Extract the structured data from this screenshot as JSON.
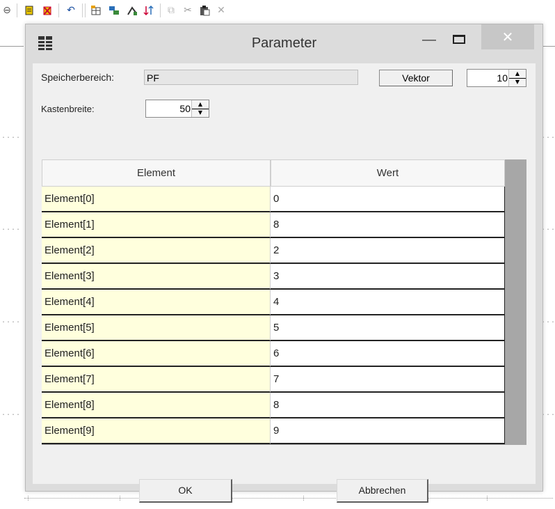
{
  "toolbar": {
    "icons": [
      "zoom-out-icon",
      "note-yellow-icon",
      "bomb-icon",
      "undo-icon",
      "table-insert-icon",
      "copy-blocks-icon",
      "route-icon",
      "sort-icon",
      "copy-icon",
      "cut-icon",
      "paste-icon",
      "delete-icon"
    ]
  },
  "dialog": {
    "title": "Parameter",
    "close_glyph": "✕",
    "minimize_glyph": "—",
    "mem_label": "Speicherbereich:",
    "mem_value": "PF",
    "vector_button": "Vektor",
    "vector_count": "10",
    "box_width_label": "Kastenbreite:",
    "box_width_value": "50",
    "columns": [
      "Element",
      "Wert"
    ],
    "rows": [
      {
        "name": "Element[0]",
        "value": "0"
      },
      {
        "name": "Element[1]",
        "value": "8"
      },
      {
        "name": "Element[2]",
        "value": "2"
      },
      {
        "name": "Element[3]",
        "value": "3"
      },
      {
        "name": "Element[4]",
        "value": "4"
      },
      {
        "name": "Element[5]",
        "value": "5"
      },
      {
        "name": "Element[6]",
        "value": "6"
      },
      {
        "name": "Element[7]",
        "value": "7"
      },
      {
        "name": "Element[8]",
        "value": "8"
      },
      {
        "name": "Element[9]",
        "value": "9"
      }
    ],
    "ok_label": "OK",
    "cancel_label": "Abbrechen"
  },
  "colors": {
    "name_cell_bg": "#ffffdd",
    "client_bg": "#f0f0f0",
    "scroll_gray": "#a7a7a7"
  }
}
